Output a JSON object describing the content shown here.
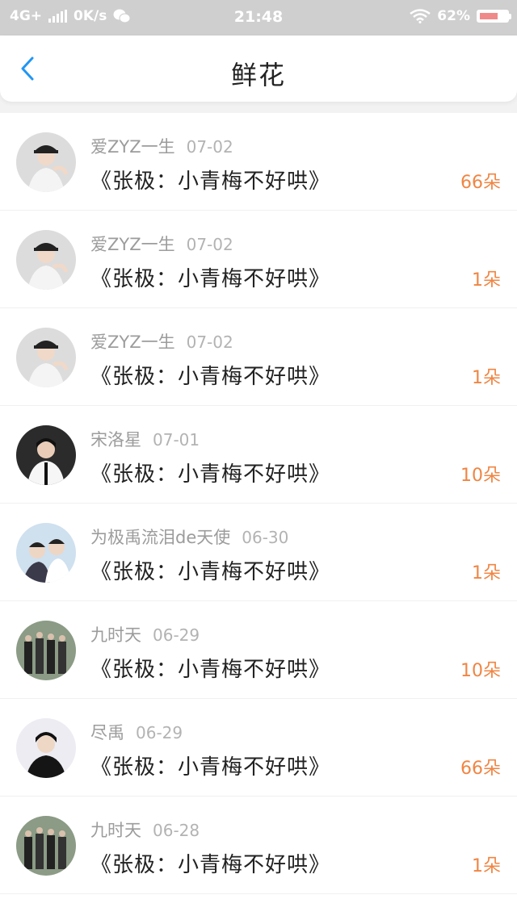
{
  "status_bar": {
    "network": "4G+",
    "speed": "0K/s",
    "time": "21:48",
    "battery": "62%",
    "battery_level": 0.62
  },
  "header": {
    "title": "鲜花",
    "back_icon": "chevron-left-icon"
  },
  "colors": {
    "accent": "#2196f3",
    "amount": "#f08543",
    "status_bar_bg": "#cfcfcf"
  },
  "rows": [
    {
      "user": "爱ZYZ一生",
      "date": "07-02",
      "book": "《张极：小青梅不好哄》",
      "amount": "66朵",
      "avatar_style": "a"
    },
    {
      "user": "爱ZYZ一生",
      "date": "07-02",
      "book": "《张极：小青梅不好哄》",
      "amount": "1朵",
      "avatar_style": "a"
    },
    {
      "user": "爱ZYZ一生",
      "date": "07-02",
      "book": "《张极：小青梅不好哄》",
      "amount": "1朵",
      "avatar_style": "a"
    },
    {
      "user": "宋洛星",
      "date": "07-01",
      "book": "《张极：小青梅不好哄》",
      "amount": "10朵",
      "avatar_style": "b"
    },
    {
      "user": "为极禹流泪de天使",
      "date": "06-30",
      "book": "《张极：小青梅不好哄》",
      "amount": "1朵",
      "avatar_style": "c"
    },
    {
      "user": "九时天",
      "date": "06-29",
      "book": "《张极：小青梅不好哄》",
      "amount": "10朵",
      "avatar_style": "d"
    },
    {
      "user": "尽禹",
      "date": "06-29",
      "book": "《张极：小青梅不好哄》",
      "amount": "66朵",
      "avatar_style": "e"
    },
    {
      "user": "九时天",
      "date": "06-28",
      "book": "《张极：小青梅不好哄》",
      "amount": "1朵",
      "avatar_style": "d"
    }
  ]
}
